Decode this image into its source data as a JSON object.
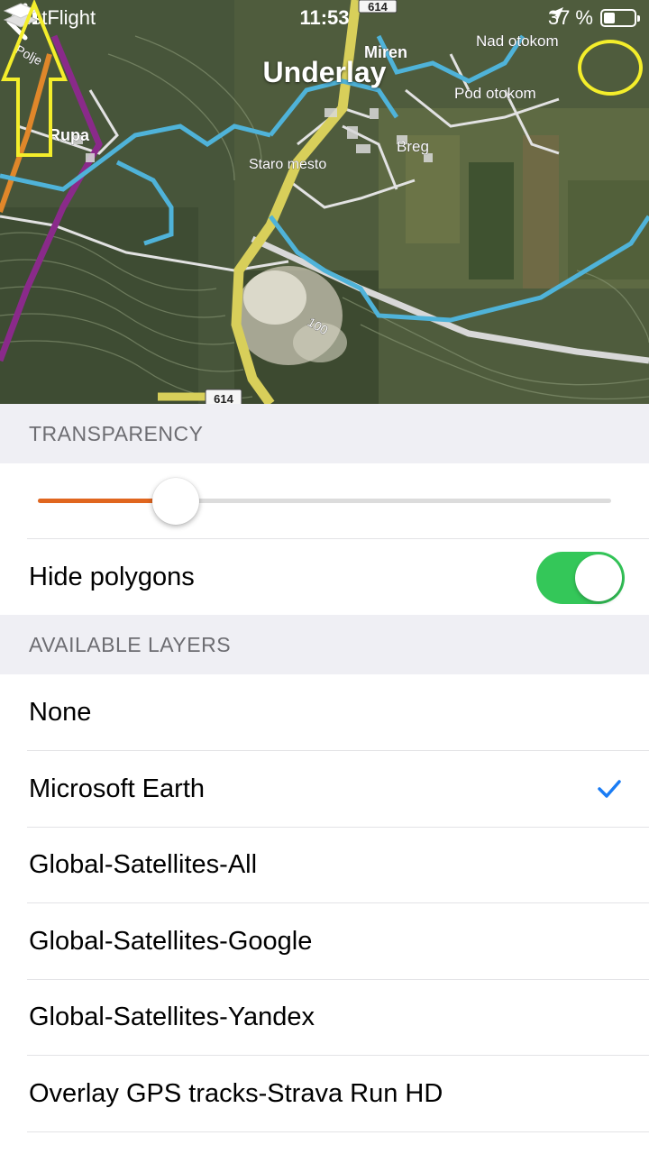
{
  "status_bar": {
    "back_app": "TestFlight",
    "time": "11:53",
    "battery_percent": "37 %",
    "battery_level": 0.37
  },
  "nav": {
    "title": "Underlay",
    "back_icon": "chevron-left-icon",
    "layers_icon": "layers-icon"
  },
  "map": {
    "labels": {
      "polje": "Polje",
      "miren": "Miren",
      "nad_otokom": "Nad otokom",
      "pod_otokom": "Pod otokom",
      "rupa": "Rupa",
      "breg": "Breg",
      "staro_mesto": "Staro mesto",
      "road_top": "614",
      "road_bottom": "614",
      "contour": "100"
    },
    "annotation_color": "#f4ee2b"
  },
  "transparency": {
    "header": "TRANSPARENCY",
    "value_fraction": 0.24,
    "accent": "#e0661f"
  },
  "hide_polygons": {
    "label": "Hide polygons",
    "on": true,
    "color": "#34c759"
  },
  "layers": {
    "header": "AVAILABLE LAYERS",
    "items": [
      {
        "label": "None",
        "selected": false
      },
      {
        "label": "Microsoft Earth",
        "selected": true
      },
      {
        "label": "Global-Satellites-All",
        "selected": false
      },
      {
        "label": "Global-Satellites-Google",
        "selected": false
      },
      {
        "label": "Global-Satellites-Yandex",
        "selected": false
      },
      {
        "label": "Overlay GPS tracks-Strava Run HD",
        "selected": false
      }
    ],
    "check_color": "#1a7cf4"
  }
}
